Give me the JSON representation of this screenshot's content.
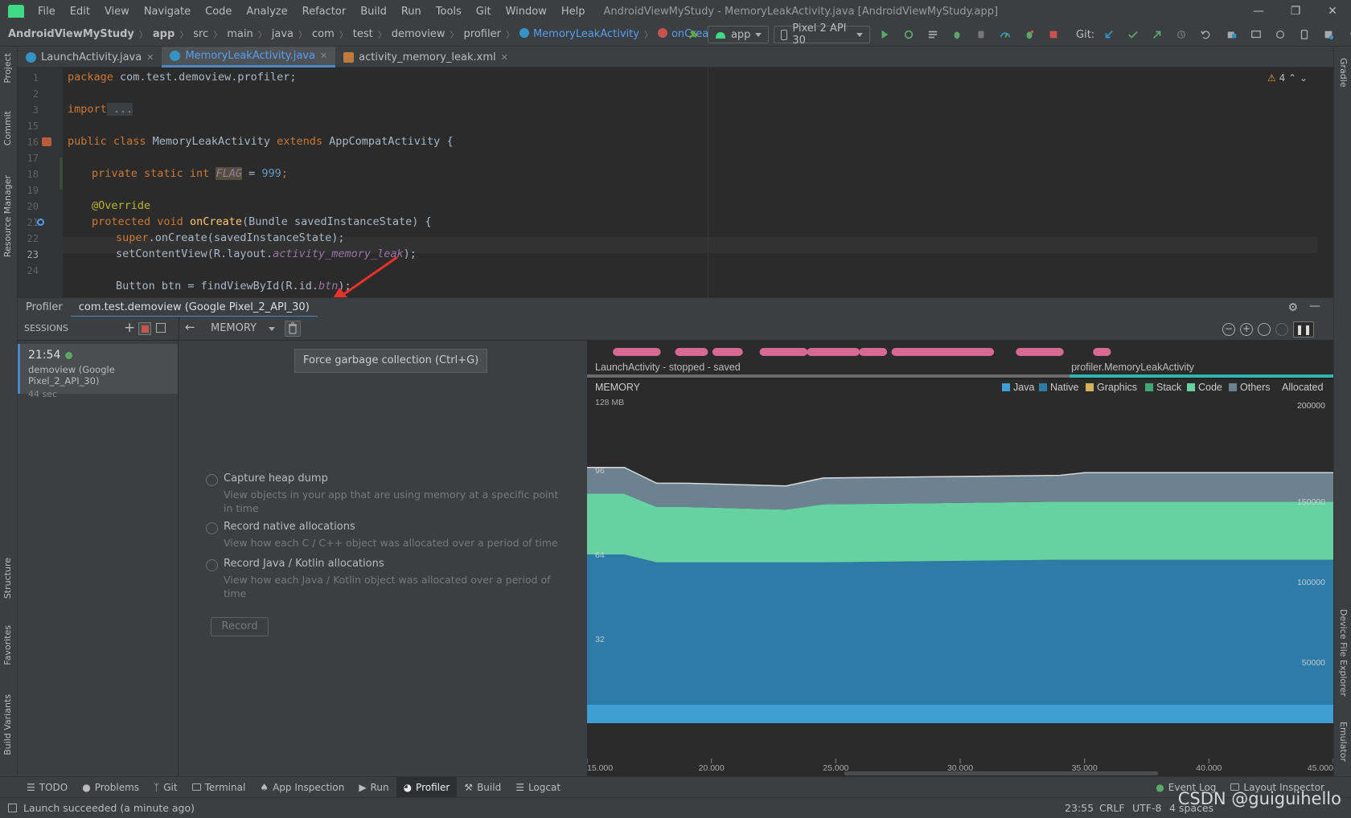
{
  "menu": {
    "items": [
      "File",
      "Edit",
      "View",
      "Navigate",
      "Code",
      "Analyze",
      "Refactor",
      "Build",
      "Run",
      "Tools",
      "Git",
      "Window",
      "Help"
    ],
    "window_title": "AndroidViewMyStudy - MemoryLeakActivity.java [AndroidViewMyStudy.app]"
  },
  "breadcrumb": [
    "AndroidViewMyStudy",
    "app",
    "src",
    "main",
    "java",
    "com",
    "test",
    "demoview",
    "profiler",
    "MemoryLeakActivity",
    "onCreate"
  ],
  "toolbar": {
    "run_config": "app",
    "device": "Pixel 2 API 30",
    "git_label": "Git:"
  },
  "editor_tabs": [
    {
      "label": "LaunchActivity.java"
    },
    {
      "label": "MemoryLeakActivity.java"
    },
    {
      "label": "activity_memory_leak.xml"
    }
  ],
  "editor": {
    "warning_count": "4",
    "line_numbers": [
      "1",
      "2",
      "3",
      "15",
      "16",
      "17",
      "18",
      "19",
      "20",
      "21",
      "22",
      "23",
      "24"
    ],
    "code": {
      "l1_kw": "package",
      "l1_rest": " com.test.demoview.profiler;",
      "l3_kw": "import",
      "l3_rest": " ...",
      "l16_a": "public class",
      "l16_b": " MemoryLeakActivity ",
      "l16_c": "extends",
      "l16_d": " AppCompatActivity {",
      "l18_kw": "private static int",
      "l18_fld": "FLAG",
      "l18_eq": " = ",
      "l18_num": "999",
      "l18_end": ";",
      "l20_ann": "@Override",
      "l21_kw": "protected void",
      "l21_fn": "onCreate",
      "l21_rest": "(Bundle savedInstanceState) {",
      "l22_kw": "super",
      "l22_rest": ".onCreate(savedInstanceState);",
      "l23_a": "setContentView(R.layout.",
      "l23_fld": "activity_memory_leak",
      "l23_end": ");",
      "l25_a": "Button btn = findViewById(R.id.",
      "l25_fld": "btn",
      "l25_end": ");"
    }
  },
  "profiler": {
    "tabs": [
      "Profiler",
      "com.test.demoview (Google Pixel_2_API_30)"
    ],
    "sessions_label": "SESSIONS",
    "memory_label": "MEMORY",
    "session": {
      "time": "21:54",
      "name": "demoview (Google Pixel_2_API_30)",
      "duration": "44 sec"
    },
    "tooltip": "Force garbage collection (Ctrl+G)",
    "options": [
      {
        "title": "Capture heap dump",
        "desc": "View objects in your app that are using memory at a specific point in time"
      },
      {
        "title": "Record native allocations",
        "desc": "View how each C / C++ object was allocated over a period of time"
      },
      {
        "title": "Record Java / Kotlin allocations",
        "desc": "View how each Java / Kotlin object was allocated over a period of time"
      }
    ],
    "record_label": "Record",
    "timeline": {
      "left_activity": "LaunchActivity - stopped - saved",
      "right_activity": "profiler.MemoryLeakActivity"
    },
    "colors": {
      "java": "#3f9fd5",
      "native": "#2d7ca8",
      "graphics": "#d6b25a",
      "stack": "#3da876",
      "code": "#66d1a1",
      "others": "#6d8291",
      "event_dot": "#d66a93",
      "accent": "#4a88c7"
    }
  },
  "chart_data": {
    "type": "area",
    "title": "MEMORY",
    "left_axis_top_label": "128 MB",
    "left_ticks": [
      "96",
      "64",
      "32"
    ],
    "right_ticks": [
      "200000",
      "150000",
      "100000",
      "50000"
    ],
    "x_ticks": [
      "15.000",
      "20.000",
      "25.000",
      "30.000",
      "35.000",
      "40.000",
      "45.000"
    ],
    "xlim": [
      15,
      45
    ],
    "ylim": [
      0,
      128
    ],
    "legend": [
      "Java",
      "Native",
      "Graphics",
      "Stack",
      "Code",
      "Others",
      "Allocated"
    ],
    "x": [
      15,
      16.5,
      17.8,
      19,
      23,
      24.5,
      34,
      35,
      45
    ],
    "series": [
      {
        "name": "Java",
        "values": [
          7,
          7,
          7,
          7,
          7,
          7,
          7,
          7,
          7
        ]
      },
      {
        "name": "Native",
        "values": [
          57,
          57,
          54,
          54,
          54,
          54,
          55,
          55,
          55
        ]
      },
      {
        "name": "Code",
        "values": [
          23,
          23,
          21,
          21,
          20,
          22,
          22,
          22,
          22
        ]
      },
      {
        "name": "Others",
        "values": [
          10,
          10,
          9,
          9,
          9,
          10,
          10,
          11,
          11
        ]
      }
    ],
    "event_segments": [
      [
        16.2,
        17.8
      ],
      [
        18.7,
        19.7
      ],
      [
        20.2,
        21.1
      ],
      [
        22.1,
        23.7
      ],
      [
        24.0,
        25.8
      ],
      [
        26.1,
        26.9
      ],
      [
        27.4,
        31.2
      ],
      [
        32.4,
        34.0
      ],
      [
        35.5,
        35.9
      ]
    ],
    "activity_switch_x": 34.4
  },
  "bottom_tools": [
    "TODO",
    "Problems",
    "Git",
    "Terminal",
    "App Inspection",
    "Run",
    "Profiler",
    "Build",
    "Logcat",
    "Event Log",
    "Layout Inspector"
  ],
  "status": {
    "message": "Launch succeeded (a minute ago)",
    "right": [
      "23:55",
      "CRLF",
      "UTF-8",
      "4 spaces"
    ],
    "watermark": "CSDN @guiguihello"
  },
  "stripes": {
    "left": [
      "Project",
      "Commit",
      "Resource Manager",
      "Structure",
      "Favorites",
      "Build Variants"
    ],
    "right": [
      "Gradle",
      "Device File Explorer",
      "Emulator"
    ]
  }
}
